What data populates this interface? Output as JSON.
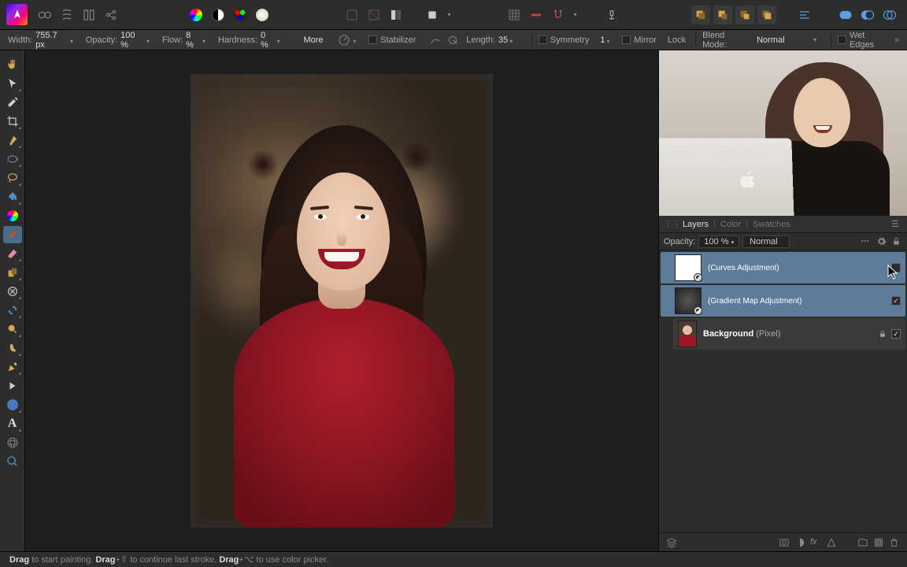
{
  "contextbar": {
    "width_label": "Width:",
    "width_value": "755.7 px",
    "opacity_label": "Opacity:",
    "opacity_value": "100 %",
    "flow_label": "Flow:",
    "flow_value": "8 %",
    "hardness_label": "Hardness:",
    "hardness_value": "0 %",
    "more": "More",
    "stabilizer": "Stabilizer",
    "length_label": "Length:",
    "length_value": "35",
    "symmetry": "Symmetry",
    "symmetry_value": "1",
    "mirror": "Mirror",
    "lock": "Lock",
    "blend_mode_label": "Blend Mode:",
    "blend_mode_value": "Normal",
    "wet_edges": "Wet Edges"
  },
  "panel_tabs": {
    "layers": "Layers",
    "color": "Color",
    "swatches": "Swatches"
  },
  "opacity_row": {
    "label": "Opacity:",
    "value": "100 %",
    "blend": "Normal"
  },
  "layers": [
    {
      "name": "(Curves Adjustment)",
      "type": "adjustment",
      "selected": true,
      "visible": false
    },
    {
      "name": "(Gradient Map Adjustment)",
      "type": "adjustment",
      "selected": true,
      "visible": true
    },
    {
      "name_bold": "Background",
      "name_suffix": " (Pixel)",
      "type": "pixel",
      "selected": false,
      "visible": true,
      "locked": true
    }
  ],
  "status": {
    "p1a": "Drag",
    "p1b": " to start painting. ",
    "p2a": "Drag",
    "p2b": "+⇧ to continue last stroke. ",
    "p3a": "Drag",
    "p3b": "+⌥ to use color picker."
  }
}
